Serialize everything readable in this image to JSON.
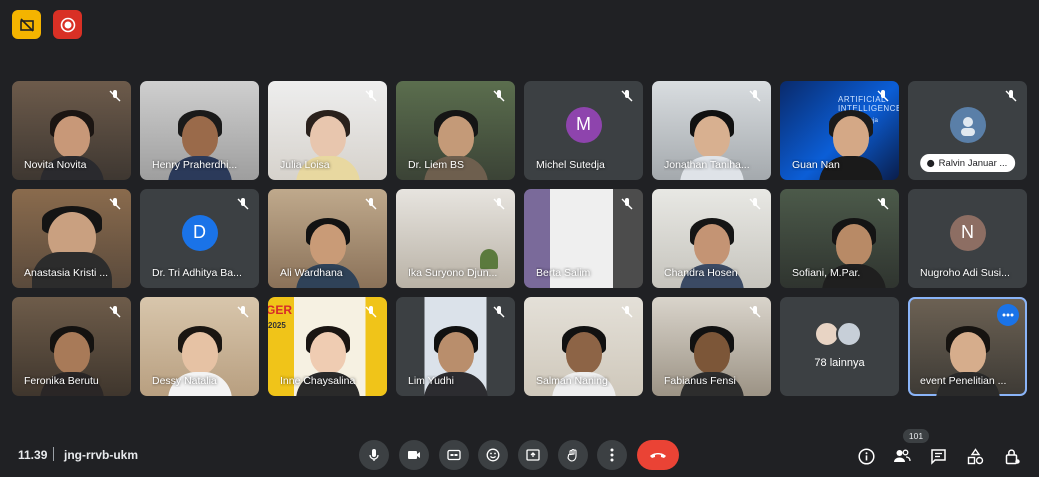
{
  "topbar": {
    "camera_off_icon": "camera-off-icon",
    "record_icon": "record-icon"
  },
  "participants": [
    {
      "name": "Novita Novita"
    },
    {
      "name": "Henry Praherdhi..."
    },
    {
      "name": "Julia Loisa"
    },
    {
      "name": "Dr. Liem BS"
    },
    {
      "name": "Michel Sutedja",
      "initial": "M"
    },
    {
      "name": "Jonathan Taniha..."
    },
    {
      "name": "Guan Nan"
    },
    {
      "name": "Ralvin Januar ..."
    },
    {
      "name": "Anastasia Kristi ..."
    },
    {
      "name": "Dr. Tri Adhitya Ba..."
    },
    {
      "name": "Ali Wardhana"
    },
    {
      "name": "Ika Suryono Djun..."
    },
    {
      "name": "Berta Salim"
    },
    {
      "name": "Chandra Hosen"
    },
    {
      "name": "Sofiani, M.Par."
    },
    {
      "name": "Nugroho Adi Susi...",
      "initial": "N"
    },
    {
      "name": "Feronika Berutu"
    },
    {
      "name": "Dessy Natalia"
    },
    {
      "name": "Inne Chaysalina"
    },
    {
      "name": "Lim Yudhi"
    },
    {
      "name": "Salman Naning"
    },
    {
      "name": "Fabianus Fensi"
    },
    {
      "name": "78 lainnya"
    },
    {
      "name": "event Penelitian ..."
    }
  ],
  "tile_extras": {
    "tri_initial": "D",
    "guan_slide_text": "ARTIFICIAL INTELLIGENCE",
    "guan_slide_sub": "m Pembelaja",
    "inne_banner": "GER",
    "inne_banner_year": "2025"
  },
  "bottom": {
    "time": "11.39",
    "separator": "|",
    "meeting_code": "jng-rrvb-ukm",
    "people_count": "101"
  },
  "colors": {
    "background": "#202124",
    "tile": "#3c4043",
    "end_call": "#ea4335",
    "camera_off_button": "#f4b400",
    "record_button": "#d93025",
    "avatar_m": "#8e44ad",
    "avatar_d": "#1a73e8",
    "avatar_n": "#8d6e63",
    "selected_outline": "#8ab4f8"
  }
}
